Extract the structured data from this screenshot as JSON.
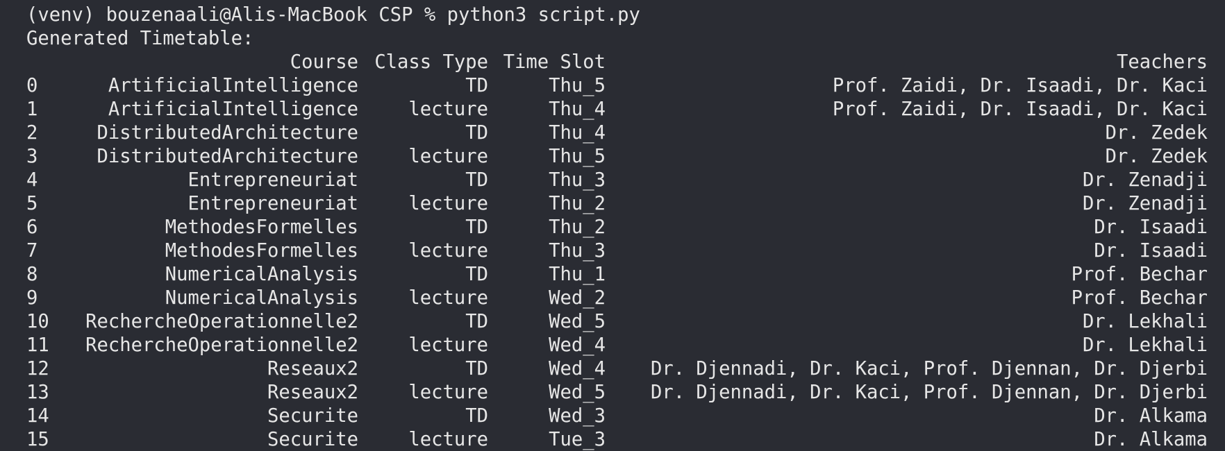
{
  "terminal": {
    "command_line": "(venv) bouzenaali@Alis-MacBook CSP % python3 script.py",
    "output_title": "Generated Timetable:",
    "columns": [
      "Course",
      "Class Type",
      "Time Slot",
      "Teachers"
    ],
    "rows": [
      {
        "idx": "0",
        "course": "ArtificialIntelligence",
        "type": "TD",
        "slot": "Thu_5",
        "teachers": "Prof. Zaidi, Dr. Isaadi, Dr. Kaci"
      },
      {
        "idx": "1",
        "course": "ArtificialIntelligence",
        "type": "lecture",
        "slot": "Thu_4",
        "teachers": "Prof. Zaidi, Dr. Isaadi, Dr. Kaci"
      },
      {
        "idx": "2",
        "course": "DistributedArchitecture",
        "type": "TD",
        "slot": "Thu_4",
        "teachers": "Dr. Zedek"
      },
      {
        "idx": "3",
        "course": "DistributedArchitecture",
        "type": "lecture",
        "slot": "Thu_5",
        "teachers": "Dr. Zedek"
      },
      {
        "idx": "4",
        "course": "Entrepreneuriat",
        "type": "TD",
        "slot": "Thu_3",
        "teachers": "Dr. Zenadji"
      },
      {
        "idx": "5",
        "course": "Entrepreneuriat",
        "type": "lecture",
        "slot": "Thu_2",
        "teachers": "Dr. Zenadji"
      },
      {
        "idx": "6",
        "course": "MethodesFormelles",
        "type": "TD",
        "slot": "Thu_2",
        "teachers": "Dr. Isaadi"
      },
      {
        "idx": "7",
        "course": "MethodesFormelles",
        "type": "lecture",
        "slot": "Thu_3",
        "teachers": "Dr. Isaadi"
      },
      {
        "idx": "8",
        "course": "NumericalAnalysis",
        "type": "TD",
        "slot": "Thu_1",
        "teachers": "Prof. Bechar"
      },
      {
        "idx": "9",
        "course": "NumericalAnalysis",
        "type": "lecture",
        "slot": "Wed_2",
        "teachers": "Prof. Bechar"
      },
      {
        "idx": "10",
        "course": "RechercheOperationnelle2",
        "type": "TD",
        "slot": "Wed_5",
        "teachers": "Dr. Lekhali"
      },
      {
        "idx": "11",
        "course": "RechercheOperationnelle2",
        "type": "lecture",
        "slot": "Wed_4",
        "teachers": "Dr. Lekhali"
      },
      {
        "idx": "12",
        "course": "Reseaux2",
        "type": "TD",
        "slot": "Wed_4",
        "teachers": "Dr. Djennadi, Dr. Kaci, Prof. Djennan, Dr. Djerbi"
      },
      {
        "idx": "13",
        "course": "Reseaux2",
        "type": "lecture",
        "slot": "Wed_5",
        "teachers": "Dr. Djennadi, Dr. Kaci, Prof. Djennan, Dr. Djerbi"
      },
      {
        "idx": "14",
        "course": "Securite",
        "type": "TD",
        "slot": "Wed_3",
        "teachers": "Dr. Alkama"
      },
      {
        "idx": "15",
        "course": "Securite",
        "type": "lecture",
        "slot": "Tue_3",
        "teachers": "Dr. Alkama"
      }
    ]
  },
  "colors": {
    "background": "#2a2c33",
    "text": "#e6e6e6"
  }
}
